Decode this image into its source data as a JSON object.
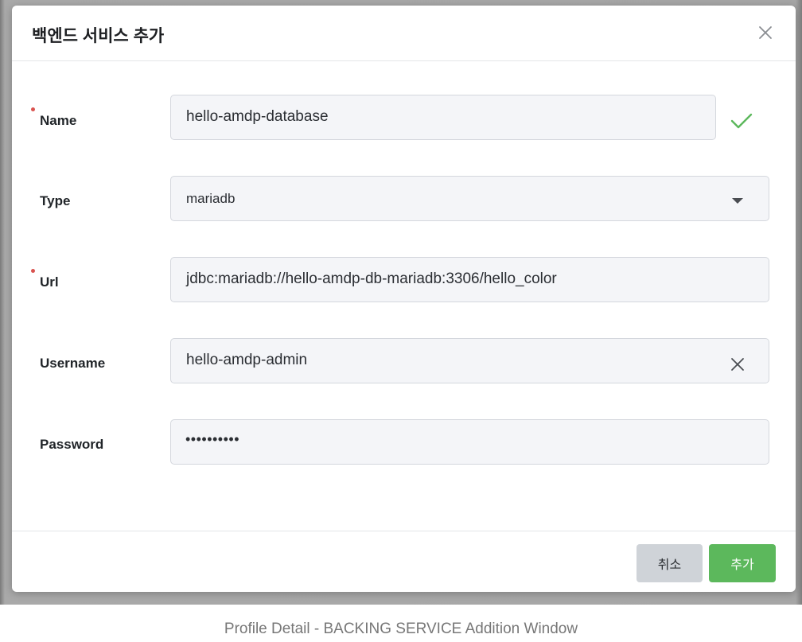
{
  "dialog": {
    "title": "백엔드 서비스 추가"
  },
  "form": {
    "name": {
      "label": "Name",
      "required": true,
      "value": "hello-amdp-database",
      "valid": true
    },
    "type": {
      "label": "Type",
      "required": false,
      "value": "mariadb"
    },
    "url": {
      "label": "Url",
      "required": true,
      "value": "jdbc:mariadb://hello-amdp-db-mariadb:3306/hello_color"
    },
    "username": {
      "label": "Username",
      "required": false,
      "value": "hello-amdp-admin"
    },
    "password": {
      "label": "Password",
      "required": false,
      "value_masked": "••••••••••"
    }
  },
  "footer": {
    "cancel_label": "취소",
    "add_label": "추가"
  },
  "caption": "Profile Detail - BACKING SERVICE Addition Window",
  "colors": {
    "required_dot": "#d9534f",
    "valid_check": "#5cb85c",
    "add_button": "#5cb85c",
    "cancel_button": "#cfd3d8"
  },
  "icons": {
    "close": "close-icon",
    "valid": "check-icon",
    "dropdown": "caret-down-icon",
    "clear": "clear-icon"
  }
}
